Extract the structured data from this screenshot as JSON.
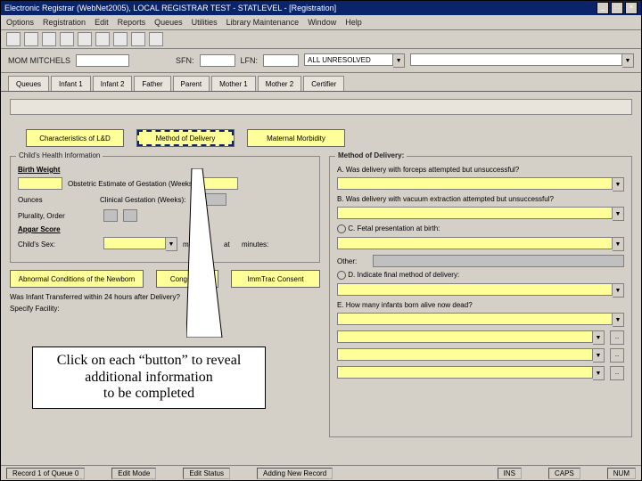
{
  "window": {
    "title": "Electronic Registrar (WebNet2005), LOCAL REGISTRAR TEST - STATLEVEL - [Registration]"
  },
  "menu": {
    "items": [
      "Options",
      "Registration",
      "Edit",
      "Reports",
      "Queues",
      "Utilities",
      "Library Maintenance",
      "Window",
      "Help"
    ]
  },
  "filter": {
    "mainlabel": "MOM MITCHELS",
    "sfn_label": "SFN:",
    "lfn_label": "LFN:",
    "status": "ALL UNRESOLVED"
  },
  "tabs": {
    "items": [
      "Queues",
      "Infant 1",
      "Infant 2",
      "Father",
      "Parent",
      "Mother 1",
      "Mother 2",
      "Certifier"
    ]
  },
  "buttons1": {
    "a": "Characteristics of L&D",
    "b": "Method of Delivery",
    "c": "Maternal Morbidity"
  },
  "left": {
    "group": "Child's Health Information",
    "birthweight": "Birth Weight",
    "obstetric": "Obstetric Estimate of Gestation (Weeks):",
    "clinical": "Clinical Gestation (Weeks):",
    "plurality": "Plurality, Order",
    "apgar": "Apgar Score",
    "childsex": "Child's Sex:",
    "minutes_lbl": "minutes:",
    "at_lbl": "at",
    "minutes2": "minutes:"
  },
  "buttons2": {
    "a": "Abnormal Conditions of the Newborn",
    "b": "Congenital",
    "c": "ImmTrac Consent"
  },
  "left2": {
    "q1": "Was Infant Transferred within 24 hours after Delivery?",
    "specify": "Specify Facility:"
  },
  "right": {
    "title": "Method of Delivery:",
    "qa": "A. Was delivery with forceps attempted but unsuccessful?",
    "qb": "B. Was delivery with vacuum extraction attempted but unsuccessful?",
    "qc": "C. Fetal presentation at birth:",
    "other": "Other:",
    "qd": "D. Indicate final method of delivery:",
    "qe": "E. How many infants born alive now dead?"
  },
  "callout": {
    "text": "Click on each “button” to reveal additional information\nto be completed"
  },
  "status": {
    "a": "Record 1 of Queue 0",
    "b": "Edit Mode",
    "c": "Edit Status",
    "d": "Adding New Record",
    "ins": "INS",
    "caps": "CAPS",
    "num": "NUM"
  }
}
